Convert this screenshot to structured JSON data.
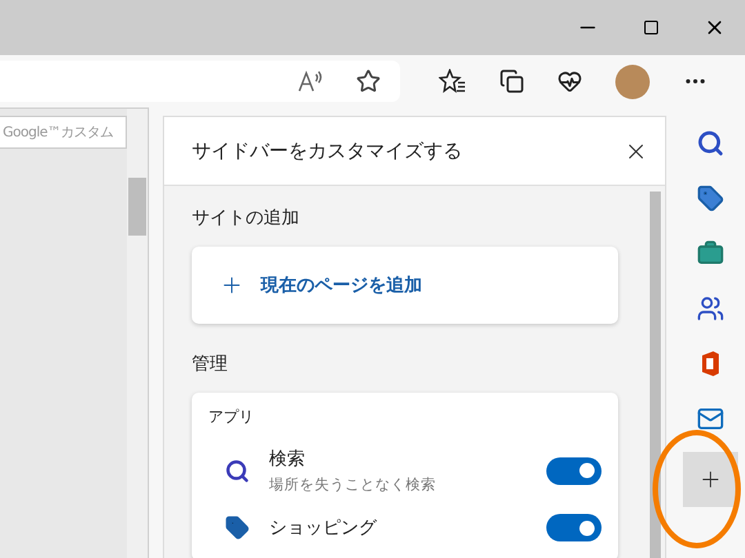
{
  "page": {
    "search_field": {
      "placeholder": "Google™カスタム"
    }
  },
  "panel": {
    "title": "サイドバーをカスタマイズする",
    "sections": [
      {
        "heading": "サイトの追加",
        "kind": "add",
        "button": "現在のページを追加"
      },
      {
        "heading": "管理",
        "kind": "apps",
        "group_label": "アプリ",
        "items": [
          {
            "kind": "search",
            "name": "検索",
            "description": "場所を失うことなく検索",
            "on": true
          },
          {
            "kind": "shopping",
            "name": "ショッピング",
            "on": true
          }
        ]
      }
    ]
  }
}
